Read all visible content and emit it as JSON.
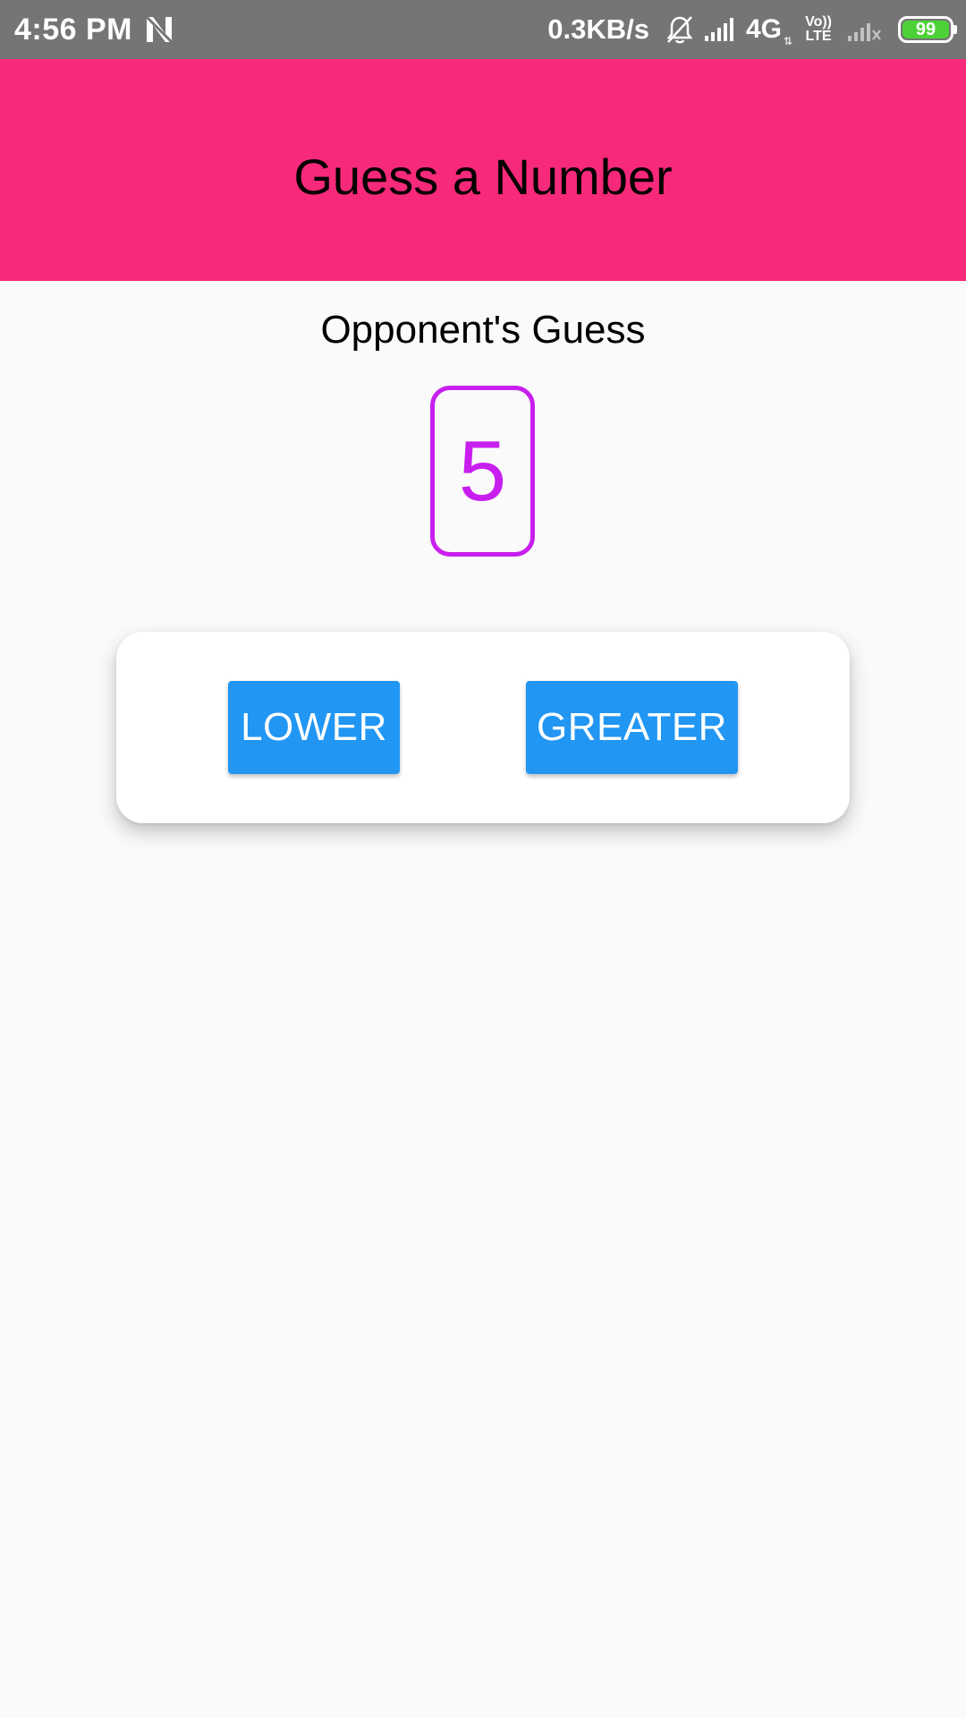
{
  "status_bar": {
    "time": "4:56 PM",
    "network_speed": "0.3KB/s",
    "network_type": "4G",
    "volte_top": "Vo))",
    "volte_bottom": "LTE",
    "battery_level": "99",
    "icons": [
      "n-notification-icon",
      "mute-bell-icon",
      "signal-icon",
      "volte-icon",
      "signal-no-sim-icon",
      "battery-icon"
    ],
    "battery_color": "#4cd137",
    "background": "#757575"
  },
  "header": {
    "title": "Guess a Number",
    "background": "#f7297a"
  },
  "main": {
    "guess_label": "Opponent's Guess",
    "current_guess": "5",
    "guess_color": "#c81fef",
    "buttons": {
      "lower_label": "LOWER",
      "greater_label": "GREATER",
      "color": "#2196f3"
    }
  }
}
